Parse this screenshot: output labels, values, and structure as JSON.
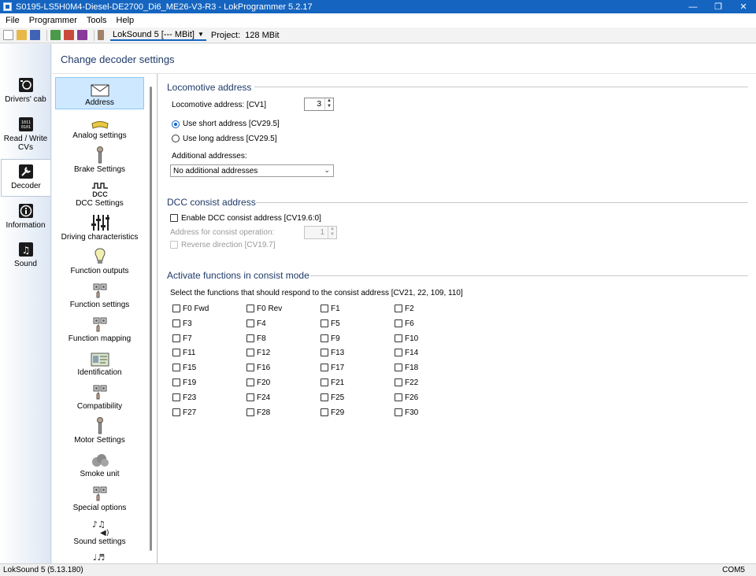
{
  "window": {
    "title": "S0195-LS5H0M4-Diesel-DE2700_Di6_ME26-V3-R3 - LokProgrammer 5.2.17",
    "minimize_glyph": "—",
    "maximize_glyph": "❐",
    "close_glyph": "✕"
  },
  "menu": [
    "File",
    "Programmer",
    "Tools",
    "Help"
  ],
  "toolbar": {
    "decoder_select": "LokSound 5 [--- MBit]",
    "project_label": "Project:",
    "project_value": "128 MBit"
  },
  "leftnav": [
    {
      "label": "Drivers' cab",
      "icon": "drivers-cab-icon"
    },
    {
      "label": "Read / Write CVs",
      "icon": "read-write-cvs-icon"
    },
    {
      "label": "Decoder",
      "icon": "wrench-icon"
    },
    {
      "label": "Information",
      "icon": "info-icon"
    },
    {
      "label": "Sound",
      "icon": "music-note-icon"
    }
  ],
  "header": {
    "title": "Change decoder settings"
  },
  "categories": [
    {
      "label": "Address",
      "icon": "envelope-icon"
    },
    {
      "label": "Analog settings",
      "icon": "analog-icon"
    },
    {
      "label": "Brake Settings",
      "icon": "brake-icon"
    },
    {
      "label": "DCC Settings",
      "icon": "dcc-icon"
    },
    {
      "label": "Driving characteristics",
      "icon": "sliders-icon"
    },
    {
      "label": "Function outputs",
      "icon": "bulb-icon"
    },
    {
      "label": "Function settings",
      "icon": "function-settings-icon"
    },
    {
      "label": "Function mapping",
      "icon": "function-mapping-icon"
    },
    {
      "label": "Identification",
      "icon": "id-card-icon"
    },
    {
      "label": "Compatibility",
      "icon": "compatibility-icon"
    },
    {
      "label": "Motor Settings",
      "icon": "motor-icon"
    },
    {
      "label": "Smoke unit",
      "icon": "smoke-icon"
    },
    {
      "label": "Special options",
      "icon": "special-options-icon"
    },
    {
      "label": "Sound settings",
      "icon": "sound-settings-icon"
    }
  ],
  "locomotive_address": {
    "section_title": "Locomotive address",
    "address_label": "Locomotive address: [CV1]",
    "address_value": "3",
    "short_label": "Use short address [CV29.5]",
    "long_label": "Use long address [CV29.5]",
    "selected": "short",
    "additional_label": "Additional addresses:",
    "additional_value": "No additional addresses"
  },
  "dcc_consist": {
    "section_title": "DCC consist address",
    "enable_label": "Enable DCC consist address [CV19.6:0]",
    "consist_address_label": "Address for consist operation:",
    "consist_address_value": "1",
    "reverse_label": "Reverse direction [CV19.7]"
  },
  "consist_functions": {
    "section_title": "Activate functions in consist mode",
    "description": "Select the functions that should respond to the consist address [CV21, 22, 109, 110]",
    "functions": [
      "F0 Fwd",
      "F0 Rev",
      "F1",
      "F2",
      "F3",
      "F4",
      "F5",
      "F6",
      "F7",
      "F8",
      "F9",
      "F10",
      "F11",
      "F12",
      "F13",
      "F14",
      "F15",
      "F16",
      "F17",
      "F18",
      "F19",
      "F20",
      "F21",
      "F22",
      "F23",
      "F24",
      "F25",
      "F26",
      "F27",
      "F28",
      "F29",
      "F30"
    ]
  },
  "status": {
    "left": "LokSound 5 (5.13.180)",
    "right": "COM5"
  },
  "colors": {
    "accent": "#1565c0",
    "section_title": "#1f3a68",
    "selected_category": "#cde8ff"
  }
}
